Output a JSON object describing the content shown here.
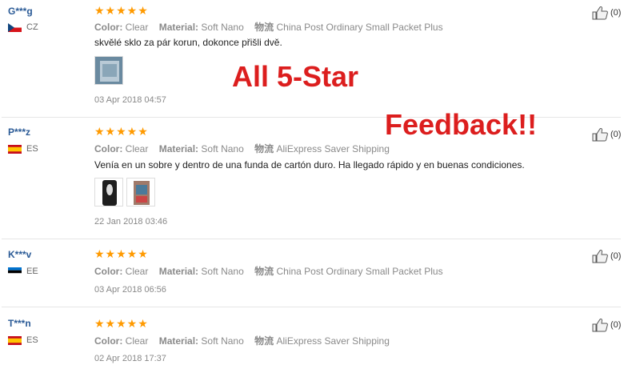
{
  "reviews": [
    {
      "user": "G***g",
      "country": "CZ",
      "flag": "cz-flag-icon",
      "rating": 5,
      "color_label": "Color:",
      "color": "Clear",
      "material_label": "Material:",
      "material": "Soft Nano",
      "shipping_label": "物流",
      "shipping": "China Post Ordinary Small Packet Plus",
      "text": "skvělé sklo za pár korun, dokonce přišli dvě.",
      "photos": [
        "review-photo"
      ],
      "date": "03 Apr 2018 04:57",
      "likes": "(0)"
    },
    {
      "user": "P***z",
      "country": "ES",
      "flag": "es-flag-icon",
      "rating": 5,
      "color_label": "Color:",
      "color": "Clear",
      "material_label": "Material:",
      "material": "Soft Nano",
      "shipping_label": "物流",
      "shipping": "AliExpress Saver Shipping",
      "text": "Venía en un sobre y dentro de una funda de cartón duro. Ha llegado rápido y en buenas condiciones.",
      "photos": [
        "review-photo",
        "review-photo"
      ],
      "date": "22 Jan 2018 03:46",
      "likes": "(0)"
    },
    {
      "user": "K***v",
      "country": "EE",
      "flag": "ee-flag-icon",
      "rating": 5,
      "color_label": "Color:",
      "color": "Clear",
      "material_label": "Material:",
      "material": "Soft Nano",
      "shipping_label": "物流",
      "shipping": "China Post Ordinary Small Packet Plus",
      "text": "",
      "photos": [],
      "date": "03 Apr 2018 06:56",
      "likes": "(0)"
    },
    {
      "user": "T***n",
      "country": "ES",
      "flag": "es-flag-icon",
      "rating": 5,
      "color_label": "Color:",
      "color": "Clear",
      "material_label": "Material:",
      "material": "Soft Nano",
      "shipping_label": "物流",
      "shipping": "AliExpress Saver Shipping",
      "text": "",
      "photos": [],
      "date": "02 Apr 2018 17:37",
      "likes": "(0)"
    }
  ],
  "overlay": {
    "line1": "All 5-Star",
    "line2": "Feedback!!"
  },
  "colors": {
    "star": "#ff9a00",
    "overlay": "#dc1e1e",
    "username": "#2a5a96"
  }
}
